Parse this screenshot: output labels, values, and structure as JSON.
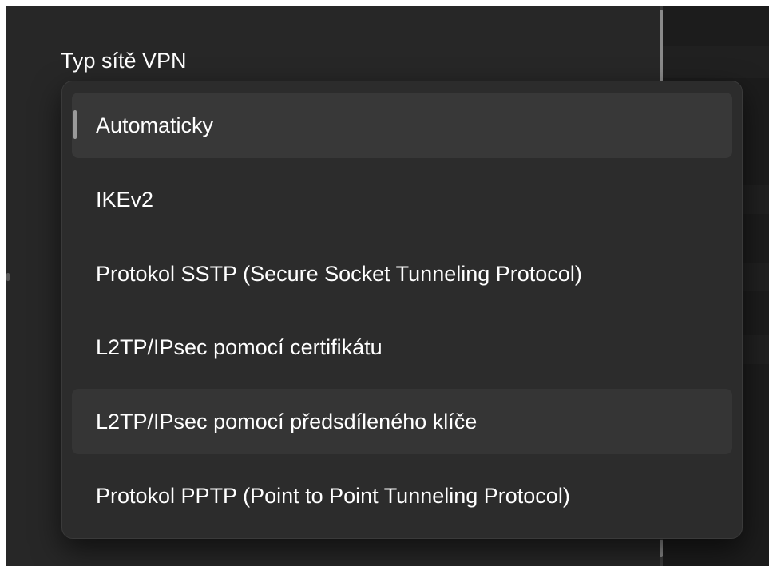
{
  "vpn_type": {
    "label": "Typ sítě VPN",
    "selected_value": "Automaticky",
    "options": [
      "Automaticky",
      "IKEv2",
      "Protokol SSTP (Secure Socket Tunneling Protocol)",
      "L2TP/IPsec pomocí certifikátu",
      "L2TP/IPsec pomocí předsdíleného klíče",
      "Protokol PPTP (Point to Point Tunneling Protocol)"
    ],
    "hovered_option": "L2TP/IPsec pomocí předsdíleného klíče"
  },
  "colors": {
    "background": "#272727",
    "flyout": "#2c2c2c",
    "selected_row": "#383838",
    "hover_row": "#353535",
    "text": "#ffffff"
  }
}
